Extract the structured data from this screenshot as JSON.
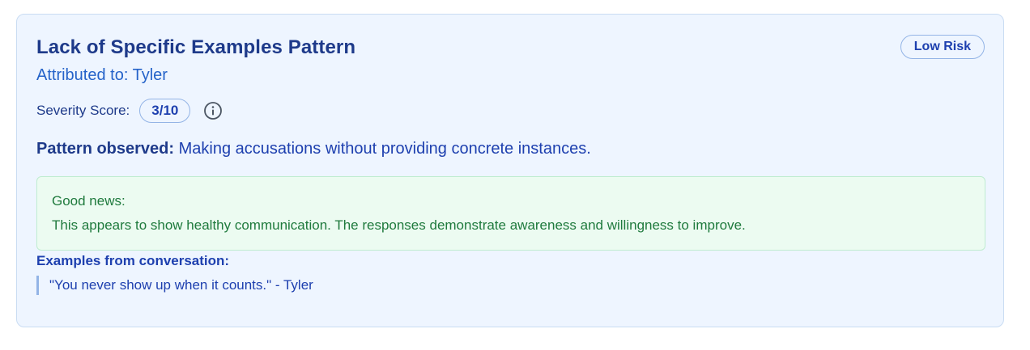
{
  "card": {
    "title": "Lack of Specific Examples Pattern",
    "risk_label": "Low Risk",
    "attributed": "Attributed to: Tyler",
    "severity_label": "Severity Score:",
    "severity_value": "3/10",
    "info_icon": "info-circle-icon",
    "pattern_label": "Pattern observed:",
    "pattern_text": "Making accusations without providing concrete instances.",
    "good_news": {
      "title": "Good news:",
      "text": "This appears to show healthy communication. The responses demonstrate awareness and willingness to improve."
    },
    "examples": {
      "title": "Examples from conversation:",
      "items": [
        "\"You never show up when it counts.\" - Tyler"
      ]
    }
  },
  "colors": {
    "card_bg": "#eef5ff",
    "accent": "#1e40af",
    "good_bg": "#ecfbf1",
    "good_text": "#1f7a3d"
  }
}
